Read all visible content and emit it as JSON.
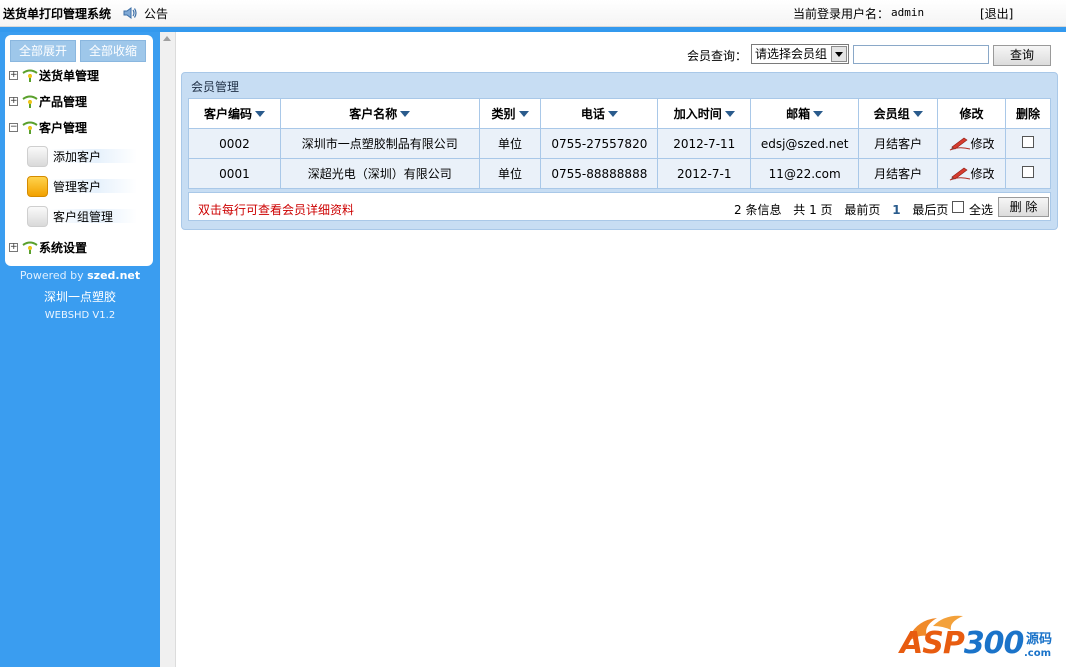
{
  "header": {
    "app_title": "送货单打印管理系统",
    "notice": "公告",
    "login_label": "当前登录用户名：",
    "login_user": "admin",
    "logout": "[退出]"
  },
  "sidebar": {
    "expand_all": "全部展开",
    "collapse_all": "全部收缩",
    "menus": [
      {
        "label": "送货单管理",
        "toggle": "+"
      },
      {
        "label": "产品管理",
        "toggle": "+"
      },
      {
        "label": "客户管理",
        "toggle": "−"
      },
      {
        "label": "系统设置",
        "toggle": "+"
      }
    ],
    "customer_items": [
      {
        "label": "添加客户"
      },
      {
        "label": "管理客户"
      },
      {
        "label": "客户组管理"
      }
    ],
    "powered_prefix": "Powered by",
    "powered_brand": "szed.net",
    "company": "深圳一点塑胶",
    "version": "WEBSHD V1.2"
  },
  "search": {
    "label": "会员查询：",
    "select_value": "请选择会员组",
    "input_value": "",
    "button": "查询"
  },
  "panel": {
    "title": "会员管理",
    "columns": [
      "客户编码",
      "客户名称",
      "类别",
      "电话",
      "加入时间",
      "邮箱",
      "会员组",
      "修改",
      "删除"
    ],
    "rows": [
      {
        "code": "0002",
        "name": "深圳市一点塑胶制品有限公司",
        "type": "单位",
        "phone": "0755-27557820",
        "joined": "2012-7-11",
        "email": "edsj@szed.net",
        "group": "月结客户",
        "edit": "修改"
      },
      {
        "code": "0001",
        "name": "深超光电（深圳）有限公司",
        "type": "单位",
        "phone": "0755-88888888",
        "joined": "2012-7-1",
        "email": "11@22.com",
        "group": "月结客户",
        "edit": "修改"
      }
    ],
    "hint": "双击每行可查看会员详细资料",
    "pager": {
      "info": "2 条信息",
      "pages": "共 1 页",
      "first": "最前页",
      "current": "1",
      "last": "最后页"
    },
    "select_all": "全选",
    "delete_button": "删 除"
  },
  "watermark": {
    "main_a": "ASP",
    "main_b": "300",
    "side": "源码",
    "com": ".com"
  },
  "colors": {
    "sidebar_blue": "#3a9df0",
    "panel_blue": "#c7ddf3",
    "hint_red": "#cc0000"
  }
}
